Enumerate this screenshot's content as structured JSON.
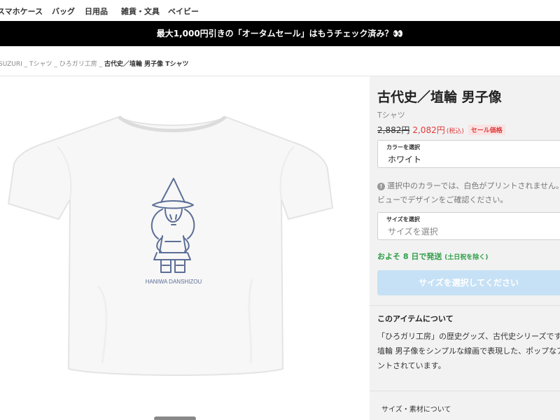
{
  "topnav": {
    "items": [
      "スマホケース",
      "バッグ",
      "日用品",
      "雑貨・文具",
      "ベイビー"
    ]
  },
  "banner": {
    "text": "最大1,000円引きの「オータムセール」はもうチェック済み？👀"
  },
  "breadcrumb": {
    "items": [
      "SUZURI",
      "Tシャツ",
      "ひろガリ工房"
    ],
    "separator": " _ ",
    "current": "古代史／埴輪 男子像 Tシャツ"
  },
  "product": {
    "title": "古代史／埴輪 男子像",
    "type": "Tシャツ",
    "price_old": "2,882円",
    "price_new": "2,082円",
    "tax": "(税込)",
    "sale_badge": "セール価格",
    "print_text": "HANIWA DANSHIZOU"
  },
  "color_select": {
    "label": "カラーを選択",
    "value": "ホワイト"
  },
  "notice": {
    "line1": "選択中のカラーでは、白色がプリントされません。必",
    "line2": "ビューでデザインをご確認ください。"
  },
  "size_select": {
    "label": "サイズを選択",
    "placeholder": "サイズを選択"
  },
  "shipping": {
    "text": "およそ 8 日で発送",
    "note": "(土日祝を除く)"
  },
  "cart_button": {
    "label": "サイズを選択してください"
  },
  "about": {
    "title": "このアイテムについて",
    "lines": [
      "「ひろガリ工房」の歴史グッズ、古代史シリーズです。",
      "埴輪 男子像をシンプルな線画で表現した、ポップなアイ",
      "ントされています。"
    ]
  },
  "spec_link": "サイズ・素材について",
  "colors": {
    "banner_bg": "#000000",
    "sale_red": "#e03a3a",
    "ship_green": "#2e9e47",
    "button_disabled": "#c6e1f5",
    "print_blue": "#5b6e96"
  }
}
